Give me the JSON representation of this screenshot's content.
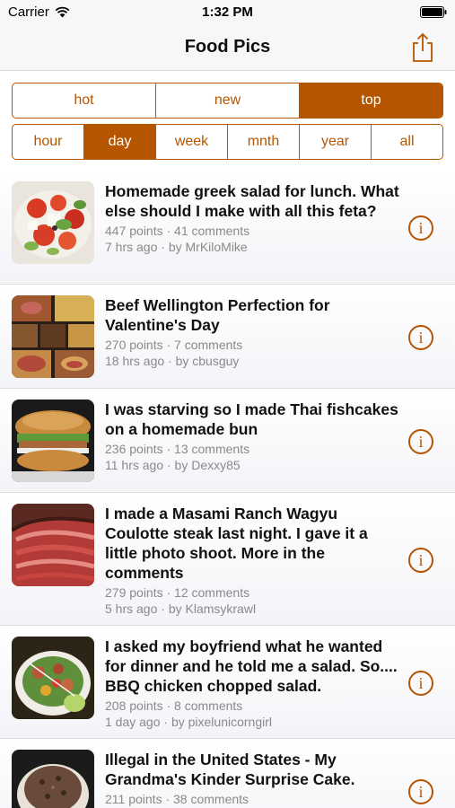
{
  "status_bar": {
    "carrier": "Carrier",
    "time": "1:32 PM"
  },
  "nav": {
    "title": "Food Pics",
    "share_icon": "share-icon"
  },
  "sort_tabs": [
    {
      "label": "hot",
      "selected": false
    },
    {
      "label": "new",
      "selected": false
    },
    {
      "label": "top",
      "selected": true
    }
  ],
  "time_tabs": [
    {
      "label": "hour",
      "selected": false
    },
    {
      "label": "day",
      "selected": true
    },
    {
      "label": "week",
      "selected": false
    },
    {
      "label": "mnth",
      "selected": false
    },
    {
      "label": "year",
      "selected": false
    },
    {
      "label": "all",
      "selected": false
    }
  ],
  "posts": [
    {
      "title": "Homemade greek salad for lunch. What else should I make with all this feta?",
      "points_comments": "447 points · 41 comments",
      "age_author": "7 hrs ago · by MrKiloMike"
    },
    {
      "title": "Beef Wellington Perfection for Valentine's Day",
      "points_comments": "270 points · 7 comments",
      "age_author": "18 hrs ago · by cbusguy"
    },
    {
      "title": "I was starving so I made Thai fishcakes on a homemade bun",
      "points_comments": "236 points · 13 comments",
      "age_author": "11 hrs ago · by Dexxy85"
    },
    {
      "title": "I made a Masami Ranch Wagyu Coulotte steak last night. I gave it a little photo shoot. More in the comments",
      "points_comments": "279 points · 12 comments",
      "age_author": "5 hrs ago · by Klamsykrawl"
    },
    {
      "title": "I asked my boyfriend what he wanted for dinner and he told me a salad. So.... BBQ chicken chopped salad.",
      "points_comments": "208 points · 8 comments",
      "age_author": "1 day ago · by pixelunicorngirl"
    },
    {
      "title": "Illegal in the United States - My Grandma's Kinder Surprise Cake.",
      "points_comments": "211 points · 38 comments",
      "age_author": ""
    }
  ],
  "info_icon": "i",
  "colors": {
    "accent": "#b65500",
    "meta_text": "#8a8a8a",
    "bar_bg": "#f7f7f7"
  }
}
